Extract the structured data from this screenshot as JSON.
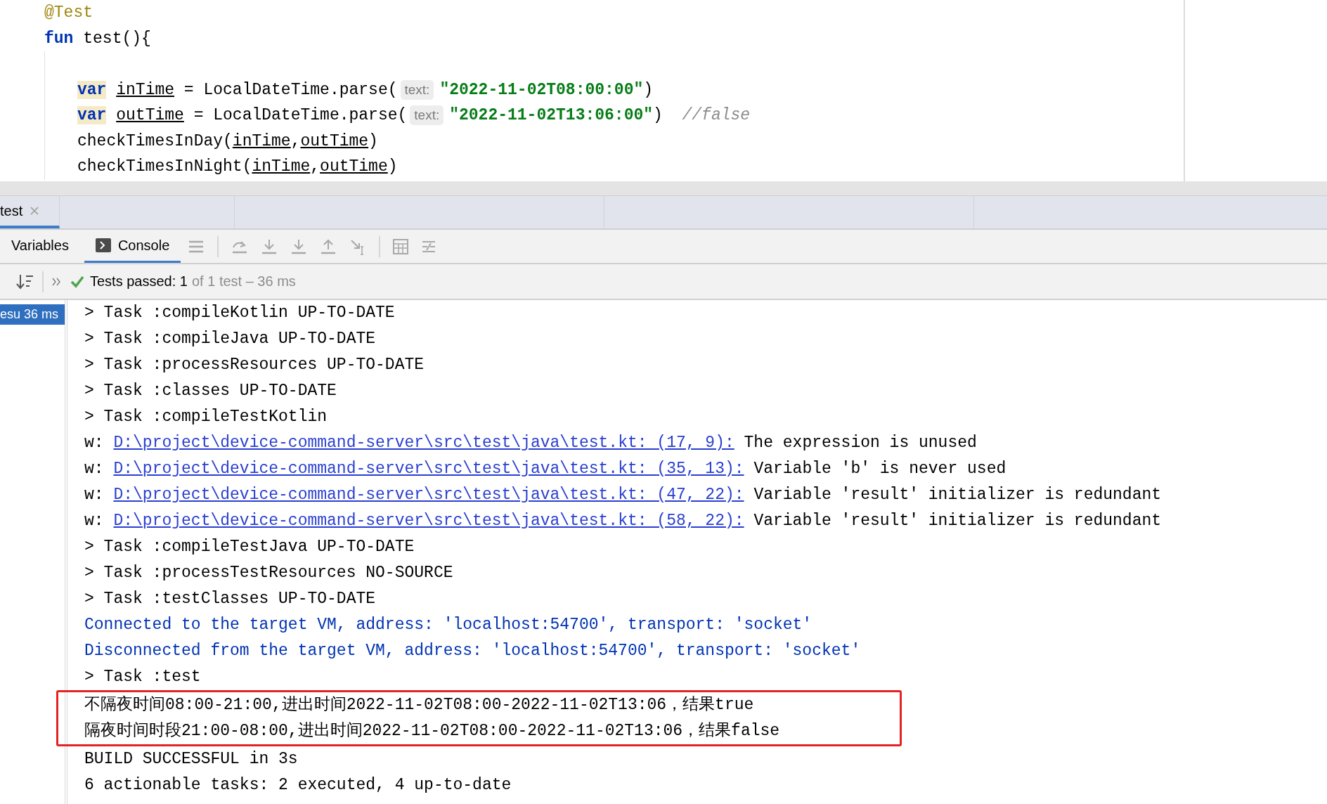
{
  "editor": {
    "lines": [
      {
        "kind": "code",
        "tokens": [
          {
            "kind": "annotation",
            "text": "@Test"
          }
        ]
      },
      {
        "kind": "code",
        "tokens": [
          {
            "kind": "keyword",
            "text": "fun"
          },
          {
            "kind": "plain",
            "text": " test(){"
          }
        ],
        "children": [
          {
            "kind": "blank"
          },
          {
            "kind": "code",
            "tokens": [
              {
                "kind": "keyword_hl",
                "text": "var"
              },
              {
                "kind": "var",
                "text": "inTime",
                "gap": true
              },
              {
                "kind": "plain",
                "text": " = LocalDateTime.parse("
              },
              {
                "kind": "hint",
                "text": "text:"
              },
              {
                "kind": "string",
                "text": "\"2022-11-02T08:00:00\""
              },
              {
                "kind": "plain",
                "text": ")"
              }
            ]
          },
          {
            "kind": "code",
            "tokens": [
              {
                "kind": "keyword_hl",
                "text": "var"
              },
              {
                "kind": "var",
                "text": "outTime",
                "gap": true
              },
              {
                "kind": "plain",
                "text": " = LocalDateTime.parse("
              },
              {
                "kind": "hint",
                "text": "text:"
              },
              {
                "kind": "string",
                "text": "\"2022-11-02T13:06:00\""
              },
              {
                "kind": "plain",
                "text": ")  "
              },
              {
                "kind": "comment",
                "text": "//false"
              }
            ]
          },
          {
            "kind": "code",
            "tokens": [
              {
                "kind": "plain",
                "text": "checkTimesInDay("
              },
              {
                "kind": "var",
                "text": "inTime",
                "suffix": ","
              },
              {
                "kind": "var",
                "text": "outTime"
              },
              {
                "kind": "plain",
                "text": ")"
              }
            ]
          },
          {
            "kind": "code",
            "tokens": [
              {
                "kind": "plain",
                "text": "checkTimesInNight("
              },
              {
                "kind": "var",
                "text": "inTime",
                "suffix": ","
              },
              {
                "kind": "var",
                "text": "outTime"
              },
              {
                "kind": "plain",
                "text": ")"
              }
            ]
          }
        ]
      }
    ]
  },
  "run_tabs": [
    {
      "label": "test",
      "selected": true
    }
  ],
  "tool_tabs": [
    {
      "label": "Variables",
      "selected": false,
      "icon": false
    },
    {
      "label": "Console",
      "selected": true,
      "icon": true
    }
  ],
  "status": {
    "passed": "Tests passed: 1",
    "detail": "of 1 test – 36 ms"
  },
  "test_tree": [
    {
      "label": "esu 36 ms",
      "selected": true
    }
  ],
  "console": {
    "lines": [
      {
        "kind": "plain",
        "text": "> Task :compileKotlin UP-TO-DATE",
        "boxed": false
      },
      {
        "kind": "plain",
        "text": "> Task :compileJava UP-TO-DATE",
        "boxed": false
      },
      {
        "kind": "plain",
        "text": "> Task :processResources UP-TO-DATE",
        "boxed": false
      },
      {
        "kind": "plain",
        "text": "> Task :classes UP-TO-DATE",
        "boxed": false
      },
      {
        "kind": "plain",
        "text": "> Task :compileTestKotlin",
        "boxed": false
      },
      {
        "kind": "warning",
        "prefix": "w: ",
        "link": "D:\\project\\device-command-server\\src\\test\\java\\test.kt: (17, 9):",
        "text": " The expression is unused",
        "boxed": false
      },
      {
        "kind": "warning",
        "prefix": "w: ",
        "link": "D:\\project\\device-command-server\\src\\test\\java\\test.kt: (35, 13):",
        "text": " Variable 'b' is never used",
        "boxed": false
      },
      {
        "kind": "warning",
        "prefix": "w: ",
        "link": "D:\\project\\device-command-server\\src\\test\\java\\test.kt: (47, 22):",
        "text": " Variable 'result' initializer is redundant",
        "boxed": false
      },
      {
        "kind": "warning",
        "prefix": "w: ",
        "link": "D:\\project\\device-command-server\\src\\test\\java\\test.kt: (58, 22):",
        "text": " Variable 'result' initializer is redundant",
        "boxed": false
      },
      {
        "kind": "plain",
        "text": "> Task :compileTestJava UP-TO-DATE",
        "boxed": false
      },
      {
        "kind": "plain",
        "text": "> Task :processTestResources NO-SOURCE",
        "boxed": false
      },
      {
        "kind": "plain",
        "text": "> Task :testClasses UP-TO-DATE",
        "boxed": false
      },
      {
        "kind": "info",
        "text": "Connected to the target VM, address: 'localhost:54700', transport: 'socket'",
        "boxed": false
      },
      {
        "kind": "info",
        "text": "Disconnected from the target VM, address: 'localhost:54700', transport: 'socket'",
        "boxed": false
      },
      {
        "kind": "plain",
        "text": "> Task :test",
        "boxed": false
      },
      {
        "kind": "output",
        "text": "不隔夜时间08:00-21:00,进出时间2022-11-02T08:00-2022-11-02T13:06，结果true",
        "boxed": true
      },
      {
        "kind": "output",
        "text": "隔夜时间时段21:00-08:00,进出时间2022-11-02T08:00-2022-11-02T13:06，结果false",
        "boxed": true
      },
      {
        "kind": "plain",
        "text": "BUILD SUCCESSFUL in 3s",
        "boxed": false
      },
      {
        "kind": "plain",
        "text": "6 actionable tasks: 2 executed, 4 up-to-date",
        "boxed": false
      }
    ]
  }
}
